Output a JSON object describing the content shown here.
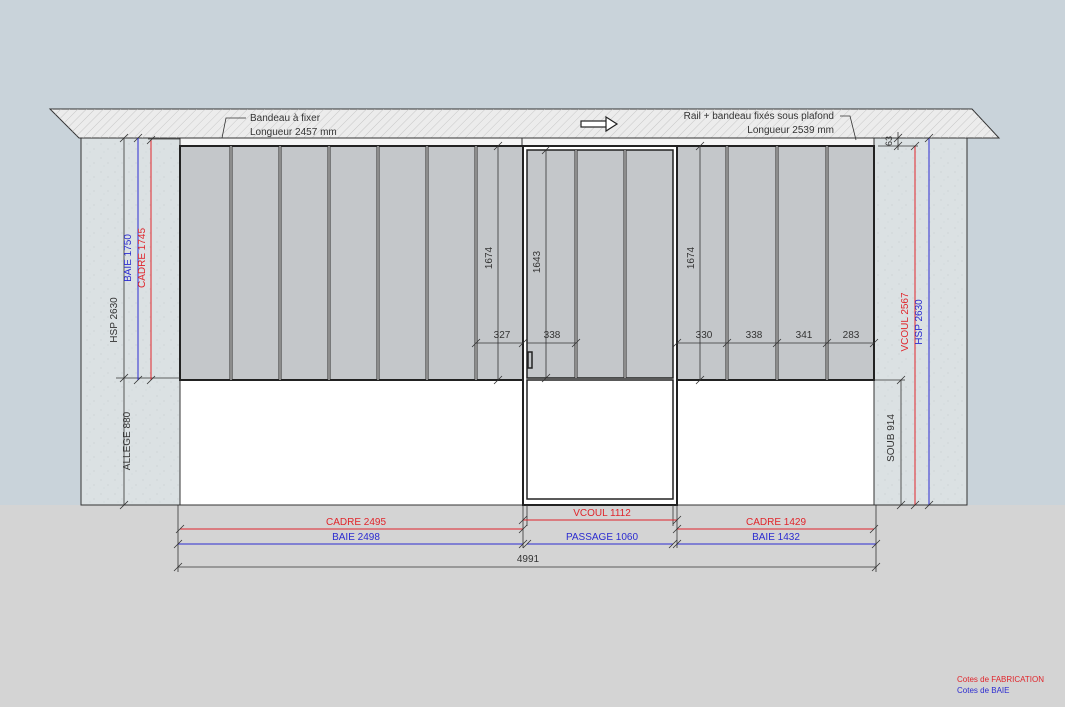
{
  "colors": {
    "sky": "#c9d3da",
    "ground": "#d4d4d4",
    "wall": "#dbe1e3",
    "glass": "#c4c7ca",
    "frame": "#2b2b2b",
    "fabrication": "#e0252b",
    "baie": "#2b2bd0",
    "dim": "#333333"
  },
  "notes": {
    "left_line1": "Bandeau à fixer",
    "left_line2": "Longueur 2457 mm",
    "right_line1": "Rail + bandeau fixés sous plafond",
    "right_line2": "Longueur 2539 mm"
  },
  "dimensions": {
    "hsp_left": "HSP 2630",
    "baie_h": "BAIE 1750",
    "cadre_h": "CADRE 1745",
    "allege": "ALLEGE 880",
    "h_1674_left": "1674",
    "h_1643": "1643",
    "h_1674_right": "1674",
    "w_327": "327",
    "w_338_door": "338",
    "w_330": "330",
    "w_338_right": "338",
    "w_341": "341",
    "w_283": "283",
    "top_63": "63",
    "vcoul_h": "VCOUL 2567",
    "hsp_right": "HSP 2630",
    "soub": "SOUB 914",
    "cadre_left": "CADRE 2495",
    "baie_left": "BAIE 2498",
    "vcoul_w": "VCOUL 1112",
    "passage": "PASSAGE 1060",
    "cadre_right": "CADRE 1429",
    "baie_right": "BAIE 1432",
    "total": "4991"
  },
  "legend": {
    "fabrication": "Cotes de FABRICATION",
    "baie": "Cotes de BAIE"
  }
}
